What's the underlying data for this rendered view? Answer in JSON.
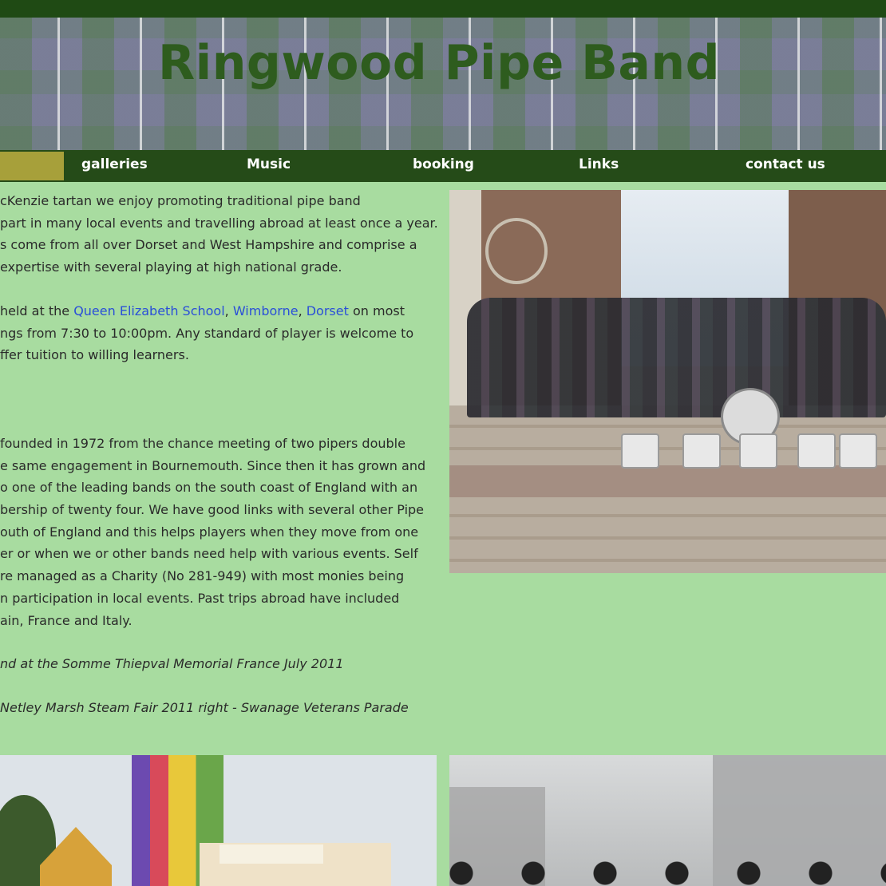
{
  "site": {
    "title": "Ringwood Pipe Band"
  },
  "colors": {
    "topbar": "#1f4a14",
    "nav_background": "#254b18",
    "nav_active": "#a7a03a",
    "title": "#2e5c1e",
    "page_background": "#a8dca0",
    "link": "#2a4fd8"
  },
  "nav": {
    "items": [
      {
        "label": "galleries"
      },
      {
        "label": "Music"
      },
      {
        "label": "booking"
      },
      {
        "label": "Links"
      },
      {
        "label": "contact us"
      }
    ]
  },
  "content": {
    "intro_lines": [
      "cKenzie tartan we enjoy promoting traditional pipe band",
      "part in many local events and travelling abroad at least once a year.",
      "s come from all over Dorset and West Hampshire and comprise a",
      "expertise with several playing at high national grade."
    ],
    "practice": {
      "line1_prefix": "held at the ",
      "link_school": "Queen Elizabeth School",
      "sep1": ", ",
      "link_town": "Wimborne",
      "sep2": ", ",
      "link_county": "Dorset",
      "line1_suffix": " on most",
      "line2": "ngs from 7:30 to 10:00pm.  Any standard of player is welcome to",
      "line3": "ffer tuition to willing learners."
    },
    "history_lines": [
      "founded in 1972 from the chance meeting of two pipers double",
      "e same engagement in Bournemouth. Since then it has grown and",
      "o one of the leading bands on the south coast of England with an",
      "bership of twenty four. We have good links with several other Pipe",
      "outh of England and this helps players when they move from one",
      "er or when we or other bands need help with various events.  Self",
      "re managed as a Charity (No 281-949) with most monies being",
      "n participation in local events. Past trips abroad have included",
      "ain, France and Italy."
    ],
    "captions": [
      "nd at the Somme Thiepval Memorial France July 2011",
      "Netley Marsh Steam Fair 2011  right - Swanage Veterans Parade"
    ]
  }
}
